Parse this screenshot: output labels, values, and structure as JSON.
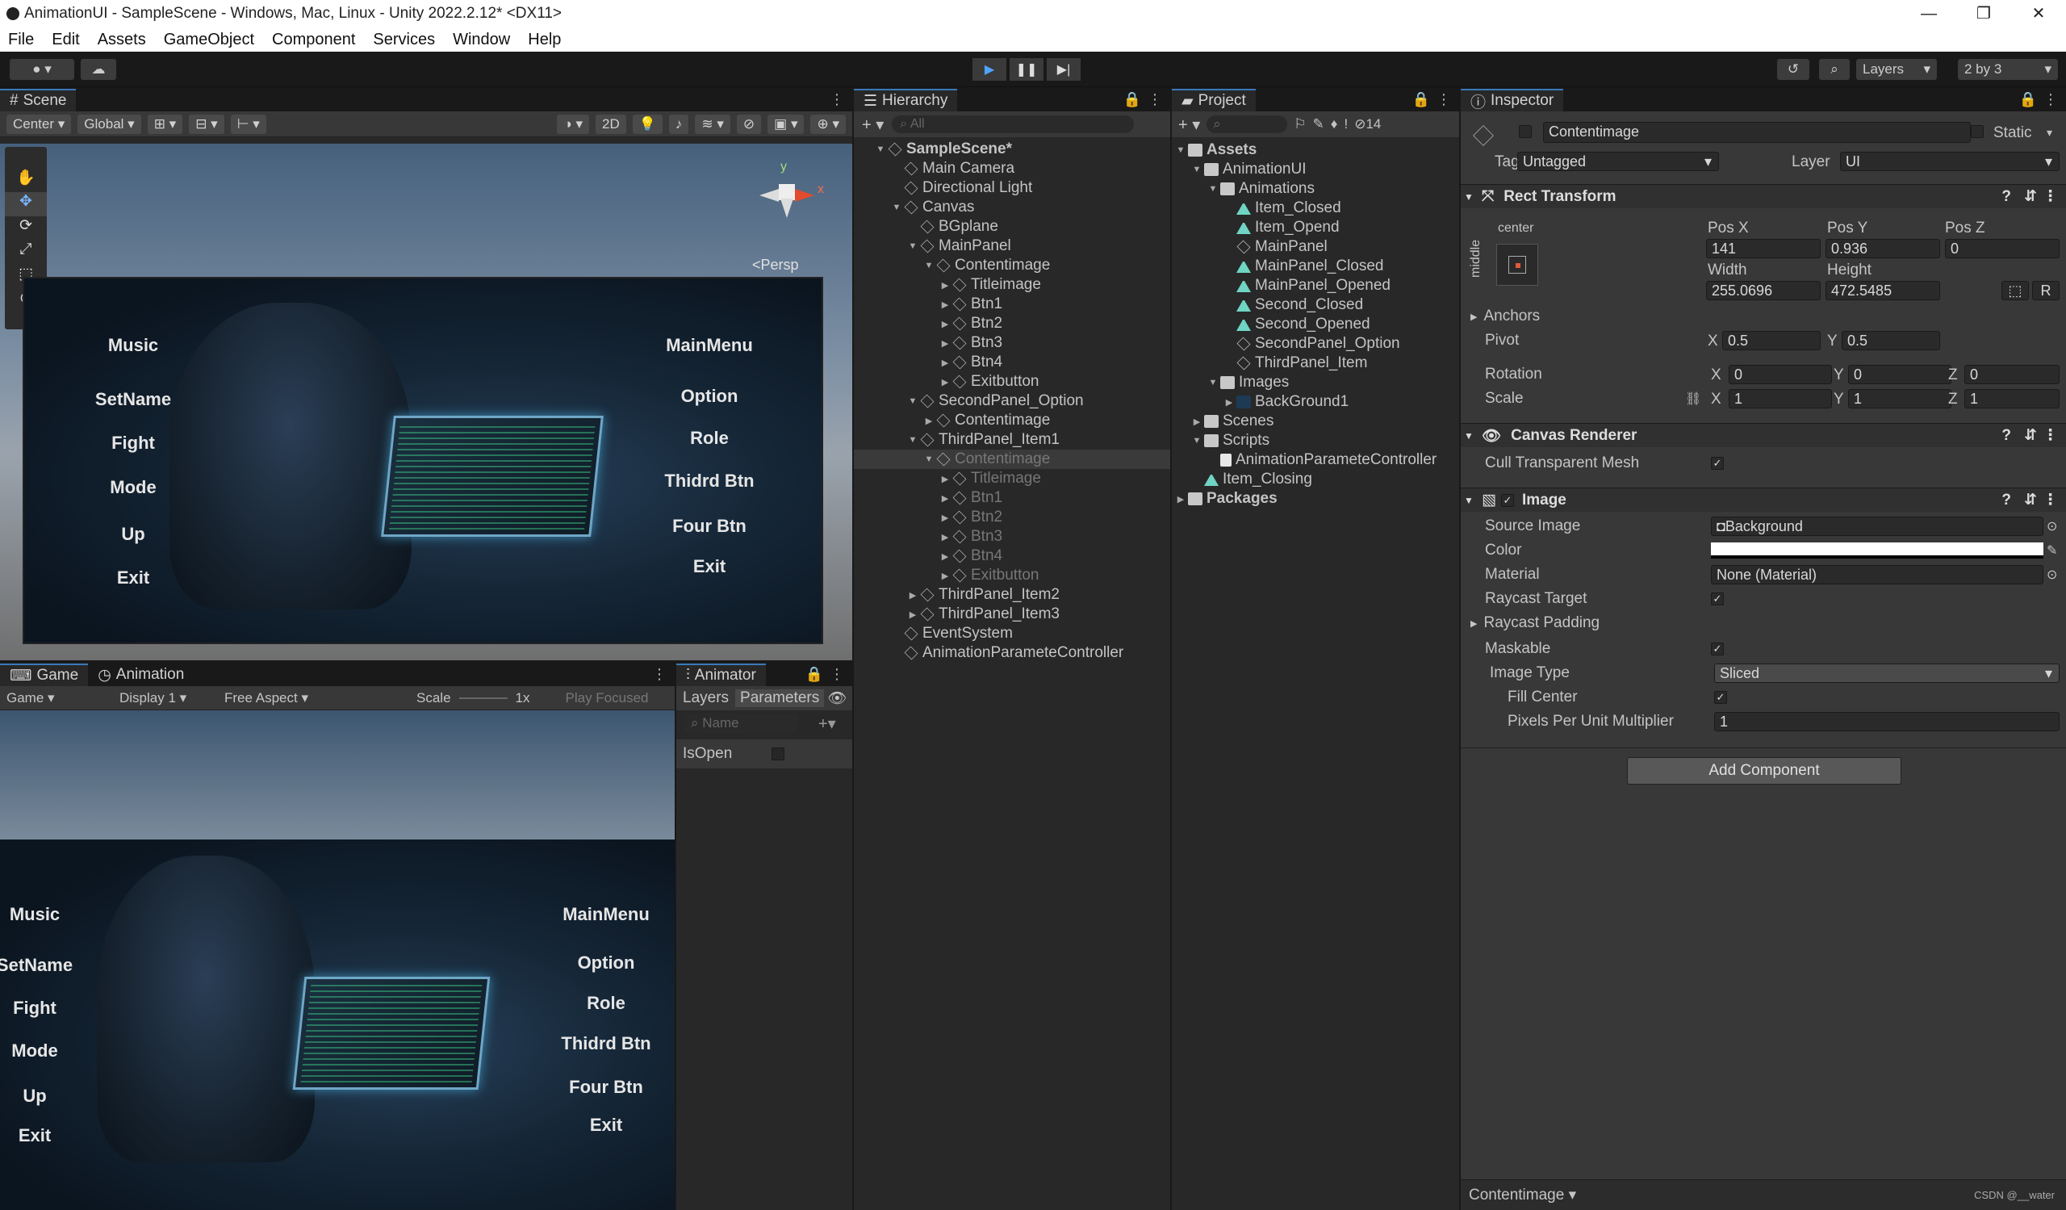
{
  "window": {
    "title": "AnimationUI - SampleScene - Windows, Mac, Linux - Unity 2022.2.12* <DX11>",
    "controls": [
      "—",
      "❐",
      "✕"
    ]
  },
  "menu": [
    "File",
    "Edit",
    "Assets",
    "GameObject",
    "Component",
    "Services",
    "Window",
    "Help"
  ],
  "toolbar": {
    "layers_label": "Layers",
    "layout_label": "2 by 3"
  },
  "scene": {
    "tab": "Scene",
    "pivot": "Center",
    "space": "Global",
    "mode_2d": "2D",
    "persp": "Persp",
    "gizmo_y": "y",
    "gizmo_x": "x"
  },
  "ui_menu": {
    "left": [
      "Music",
      "SetName",
      "Fight",
      "Mode",
      "Up",
      "Exit"
    ],
    "right": [
      "MainMenu",
      "Option",
      "Role",
      "Thidrd Btn",
      "Four Btn",
      "Exit"
    ]
  },
  "game": {
    "tab": "Game",
    "animation_tab": "Animation",
    "mode": "Game",
    "display": "Display 1",
    "aspect": "Free Aspect",
    "scale_label": "Scale",
    "scale_value": "1x",
    "play_focused": "Play Focused"
  },
  "animator": {
    "tab": "Animator",
    "layers": "Layers",
    "parameters": "Parameters",
    "search_placeholder": "Name",
    "param_name": "IsOpen",
    "param_value": false
  },
  "hierarchy": {
    "tab": "Hierarchy",
    "search_placeholder": "All",
    "rows": [
      {
        "label": "SampleScene*",
        "indent": 0,
        "arrow": "▼",
        "kind": "scene",
        "bold": true
      },
      {
        "label": "Main Camera",
        "indent": 1,
        "arrow": "",
        "kind": "cube"
      },
      {
        "label": "Directional Light",
        "indent": 1,
        "arrow": "",
        "kind": "cube"
      },
      {
        "label": "Canvas",
        "indent": 1,
        "arrow": "▼",
        "kind": "cube"
      },
      {
        "label": "BGplane",
        "indent": 2,
        "arrow": "",
        "kind": "cube"
      },
      {
        "label": "MainPanel",
        "indent": 2,
        "arrow": "▼",
        "kind": "cube"
      },
      {
        "label": "Contentimage",
        "indent": 3,
        "arrow": "▼",
        "kind": "cube"
      },
      {
        "label": "Titleimage",
        "indent": 4,
        "arrow": "▶",
        "kind": "cube"
      },
      {
        "label": "Btn1",
        "indent": 4,
        "arrow": "▶",
        "kind": "cube"
      },
      {
        "label": "Btn2",
        "indent": 4,
        "arrow": "▶",
        "kind": "cube"
      },
      {
        "label": "Btn3",
        "indent": 4,
        "arrow": "▶",
        "kind": "cube"
      },
      {
        "label": "Btn4",
        "indent": 4,
        "arrow": "▶",
        "kind": "cube"
      },
      {
        "label": "Exitbutton",
        "indent": 4,
        "arrow": "▶",
        "kind": "cube"
      },
      {
        "label": "SecondPanel_Option",
        "indent": 2,
        "arrow": "▼",
        "kind": "cube"
      },
      {
        "label": "Contentimage",
        "indent": 3,
        "arrow": "▶",
        "kind": "cube"
      },
      {
        "label": "ThirdPanel_Item1",
        "indent": 2,
        "arrow": "▼",
        "kind": "cube"
      },
      {
        "label": "Contentimage",
        "indent": 3,
        "arrow": "▼",
        "kind": "cube",
        "dim": true,
        "selected": true
      },
      {
        "label": "Titleimage",
        "indent": 4,
        "arrow": "▶",
        "kind": "cube",
        "dim": true
      },
      {
        "label": "Btn1",
        "indent": 4,
        "arrow": "▶",
        "kind": "cube",
        "dim": true
      },
      {
        "label": "Btn2",
        "indent": 4,
        "arrow": "▶",
        "kind": "cube",
        "dim": true
      },
      {
        "label": "Btn3",
        "indent": 4,
        "arrow": "▶",
        "kind": "cube",
        "dim": true
      },
      {
        "label": "Btn4",
        "indent": 4,
        "arrow": "▶",
        "kind": "cube",
        "dim": true
      },
      {
        "label": "Exitbutton",
        "indent": 4,
        "arrow": "▶",
        "kind": "cube",
        "dim": true
      },
      {
        "label": "ThirdPanel_Item2",
        "indent": 2,
        "arrow": "▶",
        "kind": "cube"
      },
      {
        "label": "ThirdPanel_Item3",
        "indent": 2,
        "arrow": "▶",
        "kind": "cube"
      },
      {
        "label": "EventSystem",
        "indent": 1,
        "arrow": "",
        "kind": "cube"
      },
      {
        "label": "AnimationParameteController",
        "indent": 1,
        "arrow": "",
        "kind": "cube"
      }
    ]
  },
  "project": {
    "tab": "Project",
    "hidden_count": "14",
    "rows": [
      {
        "label": "Assets",
        "indent": 0,
        "arrow": "▼",
        "kind": "folder",
        "bold": true
      },
      {
        "label": "AnimationUI",
        "indent": 1,
        "arrow": "▼",
        "kind": "folder"
      },
      {
        "label": "Animations",
        "indent": 2,
        "arrow": "▼",
        "kind": "folder"
      },
      {
        "label": "Item_Closed",
        "indent": 3,
        "arrow": "",
        "kind": "anim"
      },
      {
        "label": "Item_Opend",
        "indent": 3,
        "arrow": "",
        "kind": "anim"
      },
      {
        "label": "MainPanel",
        "indent": 3,
        "arrow": "",
        "kind": "ctrl"
      },
      {
        "label": "MainPanel_Closed",
        "indent": 3,
        "arrow": "",
        "kind": "anim"
      },
      {
        "label": "MainPanel_Opened",
        "indent": 3,
        "arrow": "",
        "kind": "anim"
      },
      {
        "label": "Second_Closed",
        "indent": 3,
        "arrow": "",
        "kind": "anim"
      },
      {
        "label": "Second_Opened",
        "indent": 3,
        "arrow": "",
        "kind": "anim"
      },
      {
        "label": "SecondPanel_Option",
        "indent": 3,
        "arrow": "",
        "kind": "ctrl"
      },
      {
        "label": "ThirdPanel_Item",
        "indent": 3,
        "arrow": "",
        "kind": "ctrl"
      },
      {
        "label": "Images",
        "indent": 2,
        "arrow": "▼",
        "kind": "folder"
      },
      {
        "label": "BackGround1",
        "indent": 3,
        "arrow": "▶",
        "kind": "img"
      },
      {
        "label": "Scenes",
        "indent": 1,
        "arrow": "▶",
        "kind": "folder"
      },
      {
        "label": "Scripts",
        "indent": 1,
        "arrow": "▼",
        "kind": "folder"
      },
      {
        "label": "AnimationParameteController",
        "indent": 2,
        "arrow": "",
        "kind": "script"
      },
      {
        "label": "Item_Closing",
        "indent": 1,
        "arrow": "",
        "kind": "anim"
      },
      {
        "label": "Packages",
        "indent": 0,
        "arrow": "▶",
        "kind": "folder",
        "bold": true
      }
    ]
  },
  "inspector": {
    "tab": "Inspector",
    "object_name": "Contentimage",
    "static_label": "Static",
    "tag_label": "Tag",
    "tag_value": "Untagged",
    "layer_label": "Layer",
    "layer_value": "UI",
    "rect_transform": {
      "title": "Rect Transform",
      "anchor_h": "center",
      "anchor_v": "middle",
      "posx_label": "Pos X",
      "posx": "141",
      "posy_label": "Pos Y",
      "posy": "0.936",
      "posz_label": "Pos Z",
      "posz": "0",
      "width_label": "Width",
      "width": "255.0696",
      "height_label": "Height",
      "height": "472.5485",
      "r_btn": "R",
      "anchors_label": "Anchors",
      "pivot_label": "Pivot",
      "pivot_x": "0.5",
      "pivot_y": "0.5",
      "rotation_label": "Rotation",
      "rot_x": "0",
      "rot_y": "0",
      "rot_z": "0",
      "scale_label": "Scale",
      "scale_x": "1",
      "scale_y": "1",
      "scale_z": "1",
      "x": "X",
      "y": "Y",
      "z": "Z"
    },
    "canvas_renderer": {
      "title": "Canvas Renderer",
      "cull_label": "Cull Transparent Mesh"
    },
    "image": {
      "title": "Image",
      "source_label": "Source Image",
      "source_value": "Background",
      "color_label": "Color",
      "material_label": "Material",
      "material_value": "None (Material)",
      "raycast_label": "Raycast Target",
      "raycast_padding_label": "Raycast Padding",
      "maskable_label": "Maskable",
      "image_type_label": "Image Type",
      "image_type_value": "Sliced",
      "fill_center_label": "Fill Center",
      "ppu_label": "Pixels Per Unit Multiplier",
      "ppu_value": "1"
    },
    "add_component": "Add Component",
    "footer": "Contentimage ▾",
    "watermark": "CSDN @__water"
  },
  "colors": {
    "accent": "#3a79bb",
    "anim_icon": "#6fd4c4",
    "play_active": "#4fa3ff"
  }
}
